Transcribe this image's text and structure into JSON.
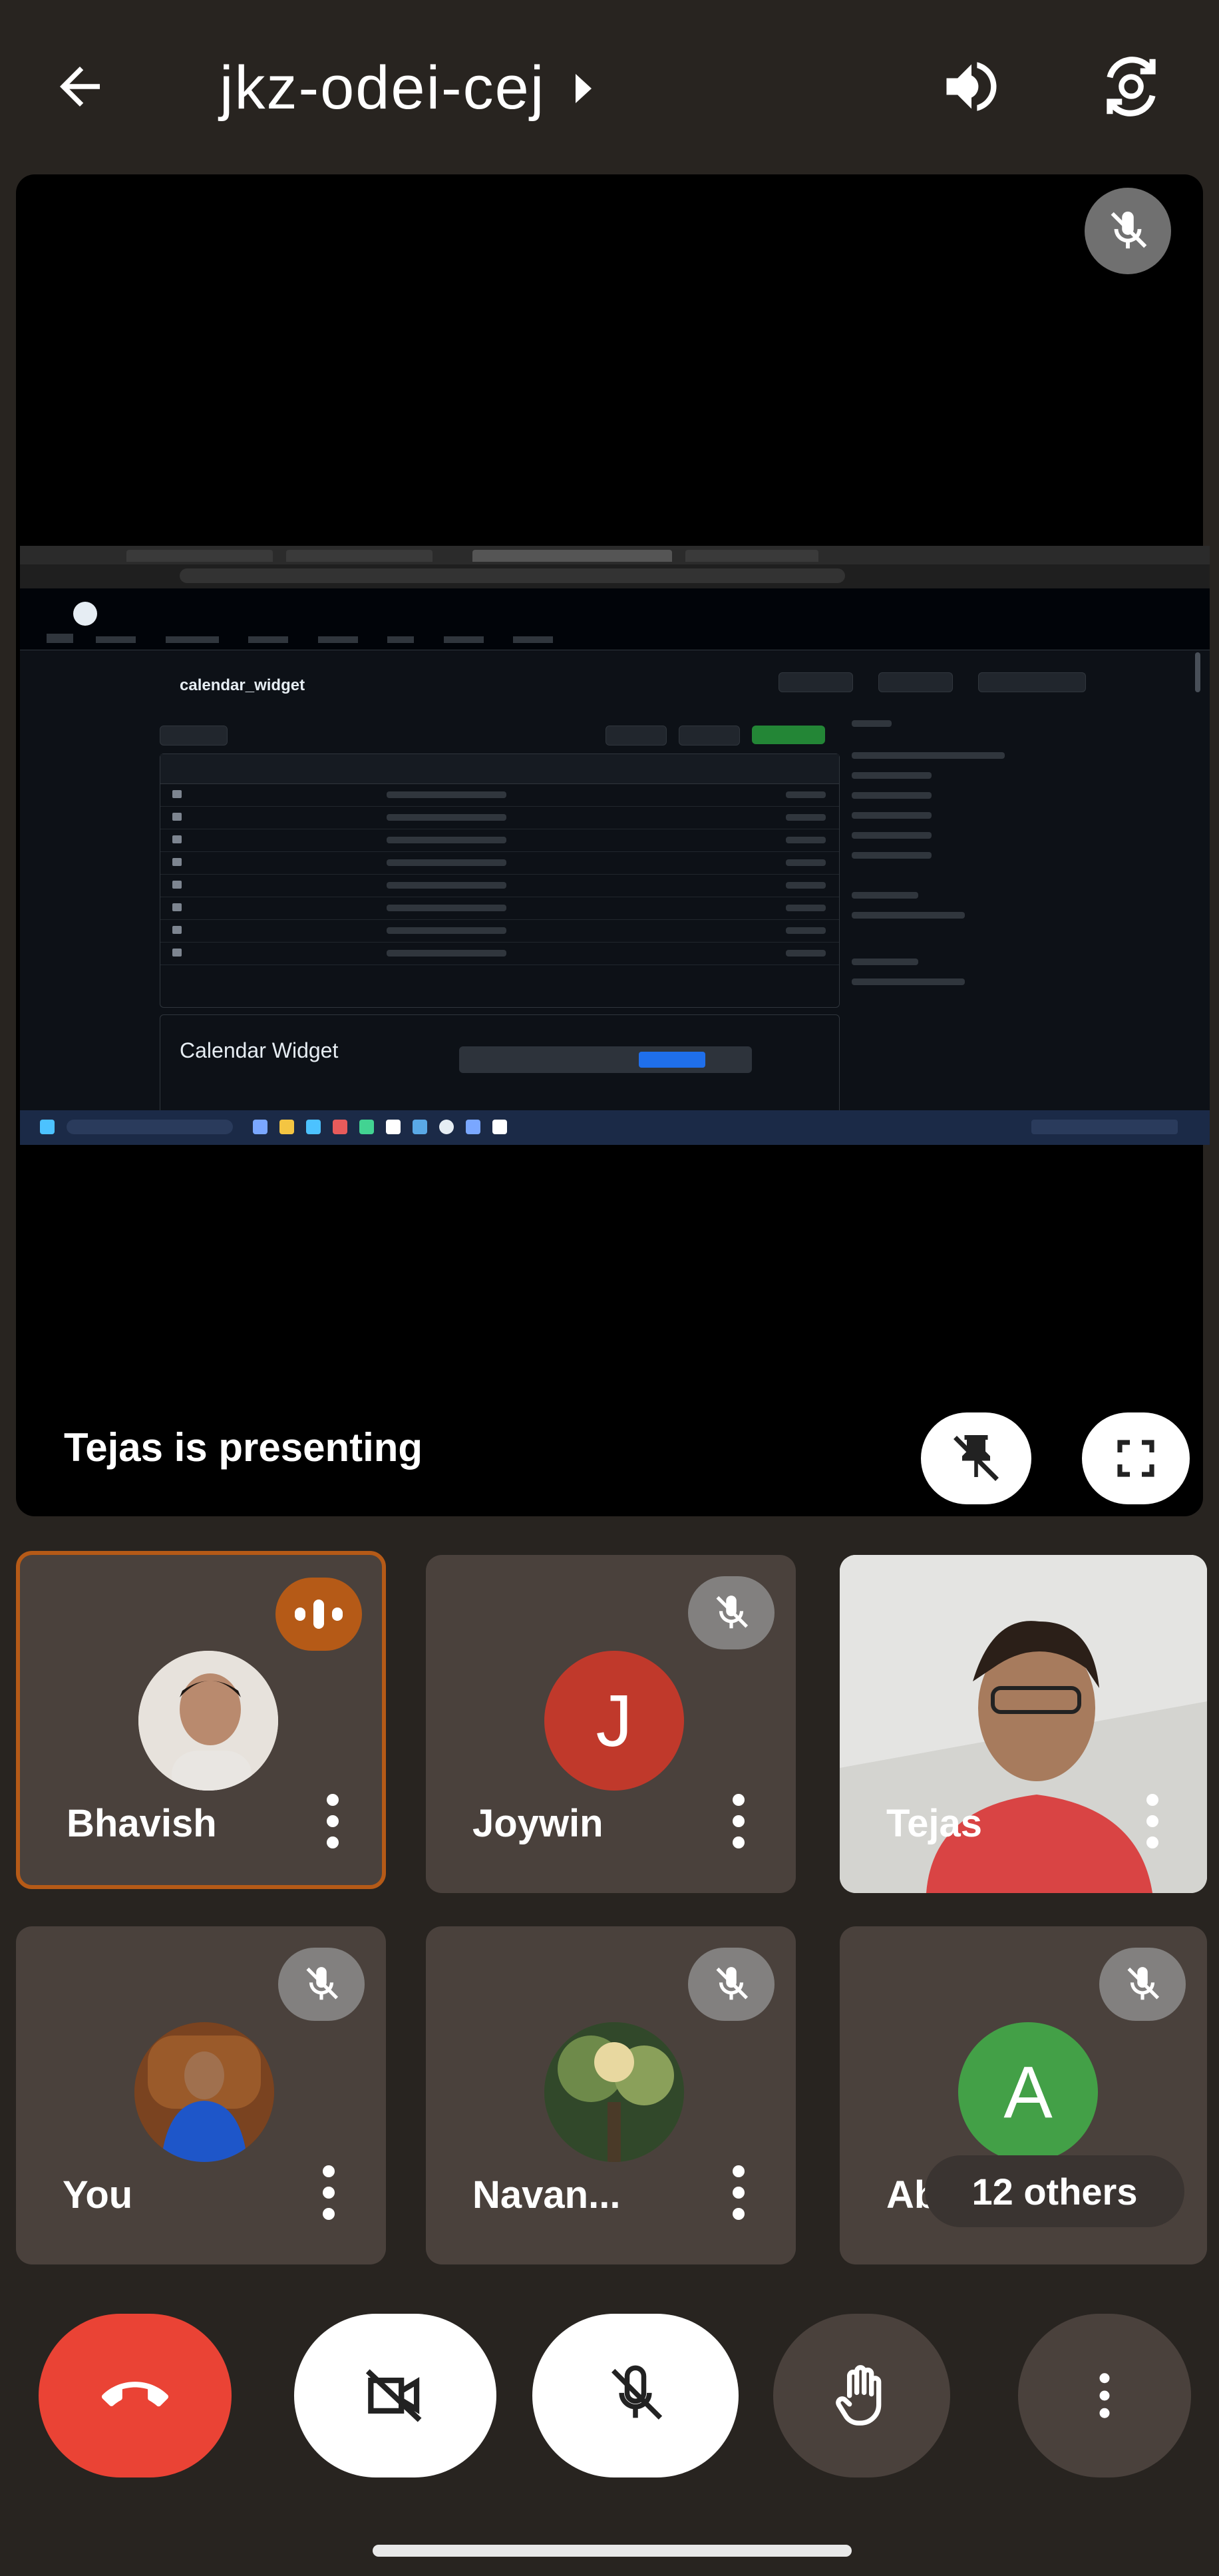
{
  "header": {
    "meeting_code": "jkz-odei-cej"
  },
  "stage": {
    "presenting_label": "Tejas is presenting",
    "shared_screen": {
      "repo_name": "calendar_widget",
      "readme_heading": "Calendar Widget"
    }
  },
  "participants": [
    {
      "name": "Bhavish",
      "speaking": true,
      "muted": false,
      "avatar": "photo"
    },
    {
      "name": "Joywin",
      "speaking": false,
      "muted": true,
      "avatar_letter": "J",
      "avatar_color": "#c0392b"
    },
    {
      "name": "Tejas",
      "speaking": false,
      "muted": false,
      "avatar": "video"
    },
    {
      "name": "You",
      "speaking": false,
      "muted": true,
      "avatar": "photo"
    },
    {
      "name": "Navan...",
      "speaking": false,
      "muted": true,
      "avatar": "photo"
    },
    {
      "name": "Ab",
      "speaking": false,
      "muted": true,
      "avatar_letter": "A",
      "avatar_color": "#43a047"
    }
  ],
  "others_pill": "12 others",
  "colors": {
    "background": "#282420",
    "tile": "#4a413c",
    "speaking_accent": "#b55a17",
    "end_call": "#ea4335"
  },
  "controls": {
    "end_call_icon": "phone-hangup-icon",
    "camera_icon": "camera-off-icon",
    "mic_icon": "mic-off-icon",
    "hand_icon": "raise-hand-icon",
    "more_icon": "more-vert-icon"
  }
}
